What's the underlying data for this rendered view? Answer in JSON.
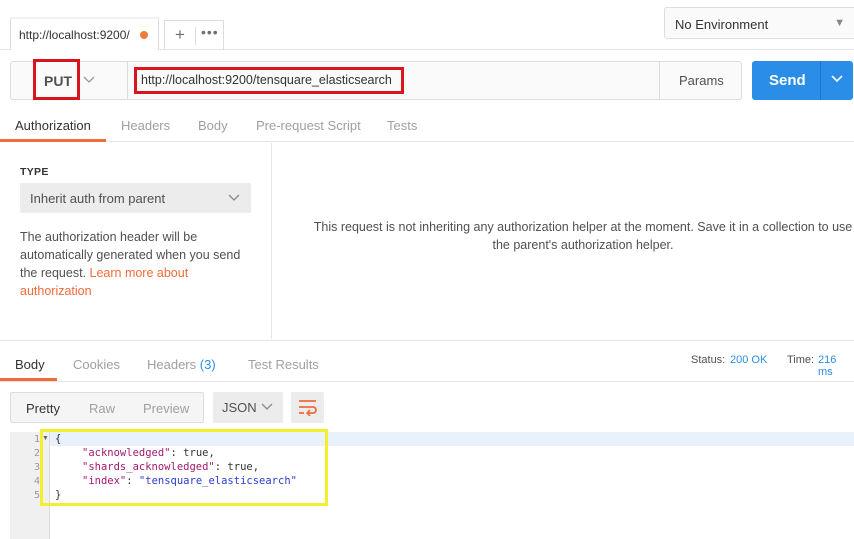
{
  "tabs": {
    "request_tab_label": "http://localhost:9200/",
    "add_label": "+",
    "more_label": "•••"
  },
  "environment": {
    "label": "No Environment"
  },
  "request": {
    "method": "PUT",
    "url": "http://localhost:9200/tensquare_elasticsearch",
    "params_label": "Params",
    "send_label": "Send"
  },
  "request_tabs": [
    "Authorization",
    "Headers",
    "Body",
    "Pre-request Script",
    "Tests"
  ],
  "auth": {
    "type_label": "TYPE",
    "type_value": "Inherit auth from parent",
    "description": "The authorization header will be automatically generated when you send the request. ",
    "learn_more": "Learn more about authorization",
    "message": "This request is not inheriting any authorization helper at the moment. Save it in a collection to use the parent's authorization helper."
  },
  "response_tabs": {
    "body": "Body",
    "cookies": "Cookies",
    "headers": "Headers",
    "headers_count": "(3)",
    "test_results": "Test Results"
  },
  "status": {
    "status_label": "Status:",
    "status_value": "200 OK",
    "time_label": "Time:",
    "time_value": "216 ms"
  },
  "format": {
    "pretty": "Pretty",
    "raw": "Raw",
    "preview": "Preview",
    "type": "JSON"
  },
  "editor": {
    "line_numbers": [
      "1",
      "2",
      "3",
      "4",
      "5"
    ],
    "open_brace": "{",
    "close_brace": "}",
    "lines": [
      {
        "key": "\"acknowledged\"",
        "value": "true",
        "suffix": ","
      },
      {
        "key": "\"shards_acknowledged\"",
        "value": "true",
        "suffix": ","
      },
      {
        "key": "\"index\"",
        "value": "\"tensquare_elasticsearch\"",
        "suffix": ""
      }
    ]
  },
  "colors": {
    "accent_orange": "#f26b3a",
    "send_blue": "#2a8ee8",
    "highlight_red": "#d9141e",
    "highlight_yellow": "#f4ef2c"
  }
}
